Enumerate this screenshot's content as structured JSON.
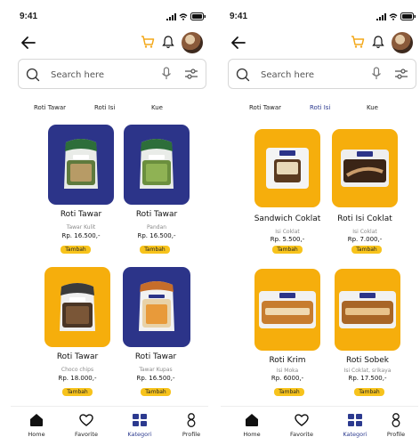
{
  "screens": [
    {
      "id": "left",
      "status": {
        "time": "9:41"
      },
      "search": {
        "placeholder": "Search here"
      },
      "tabs": [
        {
          "label": "Roti Tawar",
          "active": true
        },
        {
          "label": "Roti Isi",
          "active": false
        },
        {
          "label": "Kue",
          "active": false
        }
      ],
      "products": [
        {
          "name": "Roti  Tawar",
          "variant": "Tawar Kulit",
          "price": "Rp. 16.500,-",
          "add_label": "Tambah",
          "bg": "#2c3489",
          "pack": "bread-green-bag"
        },
        {
          "name": "Roti Tawar",
          "variant": "Pandan",
          "price": "Rp. 16.500,-",
          "add_label": "Tambah",
          "bg": "#2c3489",
          "pack": "bread-green-bag"
        },
        {
          "name": "Roti Tawar",
          "variant": "Choco chips",
          "price": "Rp. 18.000,-",
          "add_label": "Tambah",
          "bg": "#f6ae0c",
          "pack": "bread-dark-bag"
        },
        {
          "name": "Roti Tawar",
          "variant": "Tawar Kupas",
          "price": "Rp. 16.500,-",
          "add_label": "Tambah",
          "bg": "#2c3489",
          "pack": "bread-orange-bag"
        }
      ]
    },
    {
      "id": "right",
      "status": {
        "time": "9:41"
      },
      "search": {
        "placeholder": "Search here"
      },
      "tabs": [
        {
          "label": "Roti Tawar",
          "active": false
        },
        {
          "label": "Roti Isi",
          "active": true
        },
        {
          "label": "Kue",
          "active": false
        }
      ],
      "products": [
        {
          "name": "Sandwich Coklat",
          "variant": "Isi Coklat",
          "price": "Rp. 5.500,-",
          "add_label": "Tambah",
          "bg": "#f6ae0c",
          "pack": "sandwich-pack"
        },
        {
          "name": "Roti Isi Coklat",
          "variant": "Isi Coklat",
          "price": "Rp. 7.000,-",
          "add_label": "Tambah",
          "bg": "#f6ae0c",
          "pack": "coklat-pack"
        },
        {
          "name": "Roti Krim",
          "variant": "Isi Moka",
          "price": "Rp. 6000,-",
          "add_label": "Tambah",
          "bg": "#f6ae0c",
          "pack": "long-pack"
        },
        {
          "name": "Roti Sobek",
          "variant": "Isi Coklat, srikaya",
          "price": "Rp. 17.500,-",
          "add_label": "Tambah",
          "bg": "#f6ae0c",
          "pack": "long-pack-choco"
        }
      ]
    }
  ],
  "nav": [
    {
      "label": "Home",
      "icon": "home-icon"
    },
    {
      "label": "Favorite",
      "icon": "heart-icon"
    },
    {
      "label": "Kategori",
      "icon": "grid-icon"
    },
    {
      "label": "Profile",
      "icon": "person-icon"
    }
  ],
  "colors": {
    "accent": "#2c3a8f",
    "button": "#f7c31c",
    "card_blue": "#2c3489",
    "card_orange": "#f6ae0c",
    "cart": "#f3a81a"
  }
}
